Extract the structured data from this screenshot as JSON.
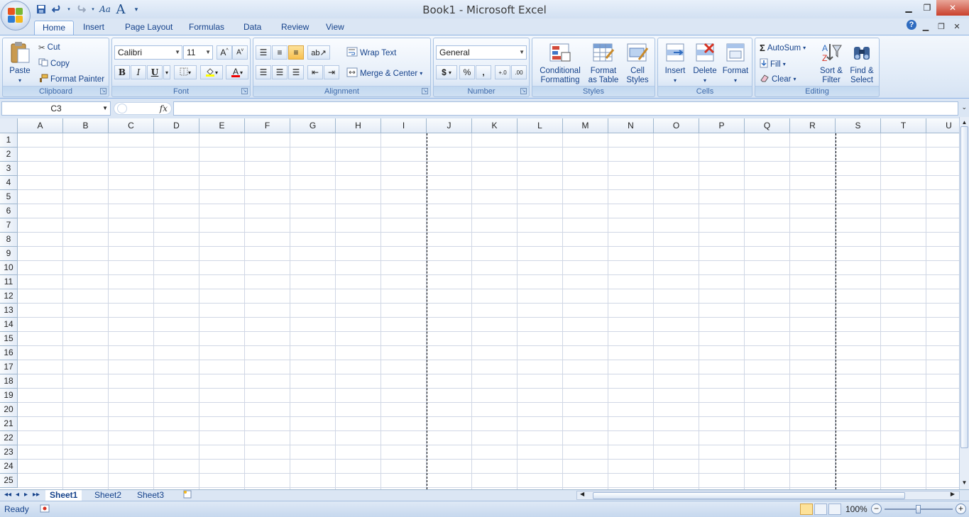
{
  "app": {
    "title": "Book1 - Microsoft Excel"
  },
  "tabs": [
    "Home",
    "Insert",
    "Page Layout",
    "Formulas",
    "Data",
    "Review",
    "View"
  ],
  "active_tab": "Home",
  "ribbon": {
    "clipboard": {
      "label": "Clipboard",
      "paste": "Paste",
      "cut": "Cut",
      "copy": "Copy",
      "format_painter": "Format Painter"
    },
    "font": {
      "label": "Font",
      "name": "Calibri",
      "size": "11",
      "bold": "B",
      "italic": "I",
      "underline": "U"
    },
    "alignment": {
      "label": "Alignment",
      "wrap_text": "Wrap Text",
      "merge_center": "Merge & Center"
    },
    "number": {
      "label": "Number",
      "format": "General",
      "currency": "$",
      "percent": "%",
      "comma": ","
    },
    "styles": {
      "label": "Styles",
      "conditional_1": "Conditional",
      "conditional_2": "Formatting",
      "format_table_1": "Format",
      "format_table_2": "as Table",
      "cell_styles_1": "Cell",
      "cell_styles_2": "Styles"
    },
    "cells": {
      "label": "Cells",
      "insert": "Insert",
      "delete": "Delete",
      "format": "Format"
    },
    "editing": {
      "label": "Editing",
      "autosum": "AutoSum",
      "fill": "Fill",
      "clear": "Clear",
      "sort_1": "Sort &",
      "sort_2": "Filter",
      "find_1": "Find &",
      "find_2": "Select"
    }
  },
  "formula_bar": {
    "name_box": "C3",
    "fx": "fx",
    "formula": ""
  },
  "columns": [
    "A",
    "B",
    "C",
    "D",
    "E",
    "F",
    "G",
    "H",
    "I",
    "J",
    "K",
    "L",
    "M",
    "N",
    "O",
    "P",
    "Q",
    "R",
    "S",
    "T",
    "U"
  ],
  "rows": [
    "1",
    "2",
    "3",
    "4",
    "5",
    "6",
    "7",
    "8",
    "9",
    "10",
    "11",
    "12",
    "13",
    "14",
    "15",
    "16",
    "17",
    "18",
    "19",
    "20",
    "21",
    "22",
    "23",
    "24",
    "25"
  ],
  "sheets": [
    "Sheet1",
    "Sheet2",
    "Sheet3"
  ],
  "active_sheet": "Sheet1",
  "status": {
    "ready": "Ready",
    "zoom": "100%"
  },
  "icons": [
    "office-button-icon",
    "save-icon",
    "undo-icon",
    "redo-icon",
    "paste-icon",
    "cut-icon",
    "copy-icon",
    "format-painter-icon",
    "close-icon",
    "help-icon"
  ]
}
